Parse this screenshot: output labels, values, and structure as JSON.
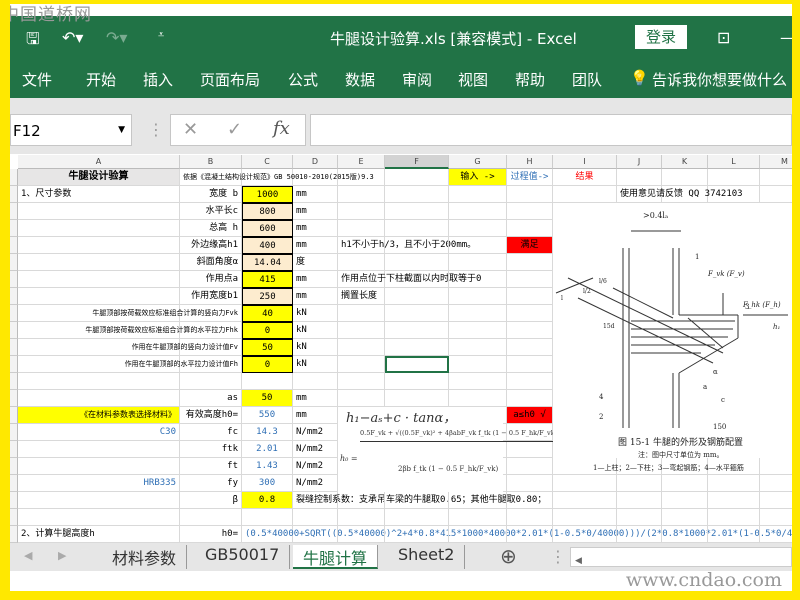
{
  "watermark_top": "中国道桥网",
  "watermark_bottom": "www.cndao.com",
  "titlebar": {
    "title": "牛腿设计验算.xls  [兼容模式]  -  Excel",
    "login": "登录",
    "save_icon": "save-icon",
    "undo_icon": "undo-icon",
    "redo_icon": "redo-icon"
  },
  "ribbon": {
    "tabs": [
      "文件",
      "开始",
      "插入",
      "页面布局",
      "公式",
      "数据",
      "审阅",
      "视图",
      "帮助",
      "团队"
    ],
    "tell_me": "告诉我你想要做什么"
  },
  "formula_bar": {
    "name_box": "F12",
    "cancel": "✕",
    "enter": "✓",
    "fx": "fx",
    "value": ""
  },
  "columns": [
    "A",
    "B",
    "C",
    "D",
    "E",
    "F",
    "G",
    "H",
    "I",
    "J",
    "K",
    "L",
    "M"
  ],
  "selected_cell": "F12",
  "cells": {
    "A1": "牛腿设计验算",
    "B1": "依据《混凝土结构设计规范》GB 50010-2010(2015版)9.3",
    "G1": "输入 ->",
    "H1": "过程值->",
    "I1": "结果",
    "A2": "1、尺寸参数",
    "B2": "宽度 b",
    "C2": "1000",
    "D2": "mm",
    "J2": "使用意见请反馈 QQ 3742103",
    "B3": "水平长c",
    "C3": "800",
    "D3": "mm",
    "B4": "总高 h",
    "C4": "600",
    "D4": "mm",
    "B5": "外边缘高h1",
    "C5": "400",
    "D5": "mm",
    "E5": "h1不小于h/3，且不小于200mm。",
    "H5": "满足",
    "B6": "斜面角度α",
    "C6": "14.04",
    "D6": "度",
    "B7": "作用点a",
    "C7": "415",
    "D7": "mm",
    "E7": "作用点位于下柱截面以内时取等于0",
    "B8": "作用宽度b1",
    "C8": "250",
    "D8": "mm",
    "E8": "搁置长度",
    "B9": "牛腿顶部按荷载效应标准组合计算的竖向力Fvk",
    "C9": "40",
    "D9": "kN",
    "B10": "牛腿顶部按荷载效应标准组合计算的水平拉力Fhk",
    "C10": "0",
    "D10": "kN",
    "B11": "作用在牛腿顶部的竖向力设计值Fv",
    "C11": "50",
    "D11": "kN",
    "B12": "作用在牛腿顶部的水平拉力设计值Fh",
    "C12": "0",
    "D12": "kN",
    "B14": "as",
    "C14": "50",
    "D14": "mm",
    "A15": "《在材料参数表选择材料》",
    "B15": "有效高度h0=",
    "C15": "550",
    "D15": "mm",
    "H15": "a≤h0 √",
    "A16": "C30",
    "B16": "fc",
    "C16": "14.3",
    "D16": "N/mm2",
    "B17": "ftk",
    "C17": "2.01",
    "D17": "N/mm2",
    "B18": "ft",
    "C18": "1.43",
    "D18": "N/mm2",
    "A19": "HRB335",
    "B19": "fy",
    "C19": "300",
    "D19": "N/mm2",
    "B20": "β",
    "C20": "0.8",
    "D20": "裂缝控制系数：支承吊车梁的牛腿取0.65；其他牛腿取0.80；",
    "A22": "2、计算牛腿高度h",
    "B22": "h0=",
    "C22": "(0.5*40000+SQRT((0.5*40000)^2+4*0.8*415*1000*40000*2.01*(1-0.5*0/40000)))/(2*0.8*1000*2.01*(1-0.5*0/40000))"
  },
  "formulas": {
    "h0_geom": "h₁−aₛ+c · tanα，",
    "h0_num": "0.5F_vk + √((0.5F_vk)² + 4βabF_vk f_tk (1 − 0.5 F_hk/F_vk))",
    "h0_den": "2βb f_tk (1 − 0.5 F_hk/F_vk)",
    "h0_lhs": "h₀ ="
  },
  "figure": {
    "caption": "图 15-1    牛腿的外形及钢筋配置",
    "note": "注：图中尺寸单位为 mm。",
    "legend": "1—上柱；2—下柱；3—弯起钢筋；4—水平箍筋",
    "labels": [
      ">0.4lₐ",
      "F_vk (F_v)",
      "F_hk (F_h)",
      "h₁",
      "α",
      "a",
      "c",
      "150",
      "15d",
      "l/2",
      "l/6",
      "l",
      "1",
      "2",
      "3",
      "4"
    ]
  },
  "sheet_tabs": {
    "tabs": [
      "材料参数",
      "GB50017",
      "牛腿计算",
      "Sheet2"
    ],
    "active": "牛腿计算"
  }
}
